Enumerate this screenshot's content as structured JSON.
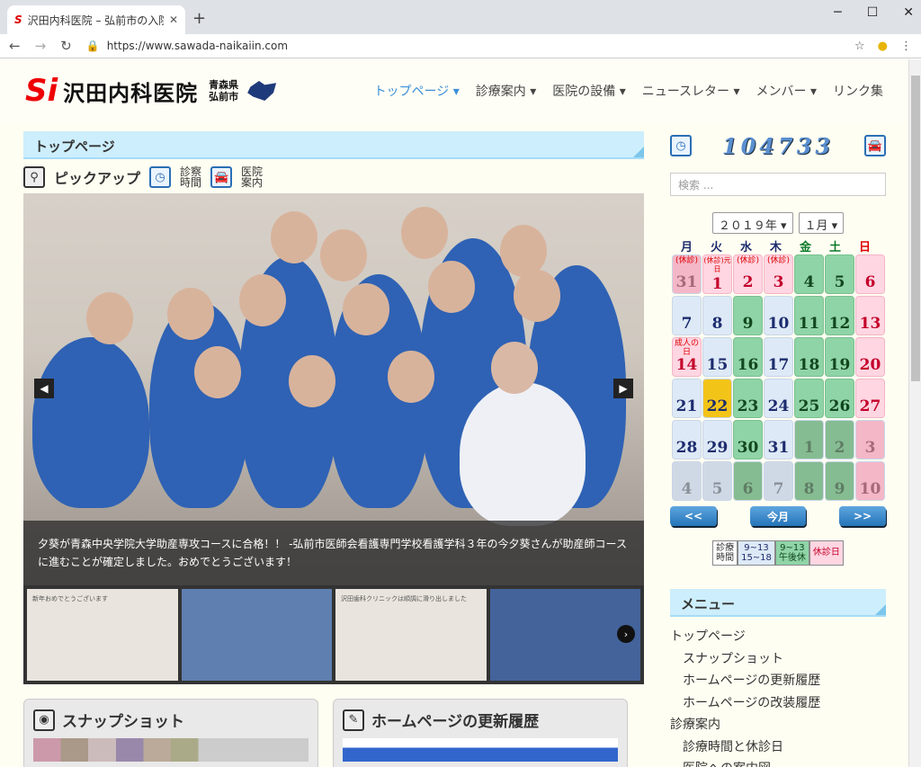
{
  "browser": {
    "tab_title": "沢田内科医院 – 弘前市の入院診療",
    "url": "https://www.sawada-naikaiin.com"
  },
  "header": {
    "logo_name": "沢田内科医院",
    "logo_loc1": "青森県",
    "logo_loc2": "弘前市",
    "menu": [
      "トップページ ▾",
      "診療案内 ▾",
      "医院の設備 ▾",
      "ニュースレター ▾",
      "メンバー ▾",
      "リンク集"
    ]
  },
  "main": {
    "section_title": "トップページ",
    "pickup": "ピックアップ",
    "link1": "診察\n時間",
    "link1a": "診察",
    "link1b": "時間",
    "link2a": "医院",
    "link2b": "案内",
    "caption": "夕葵が青森中央学院大学助産専攻コースに合格！！ -弘前市医師会看護専門学校看護学科３年の今夕葵さんが助産師コースに進むことが確定しました。おめでとうございます！",
    "thumb1": "新年おめでとうございます",
    "thumb3": "沢田歯科クリニックは順調に滑り出しました",
    "card1": "スナップショット",
    "card2": "ホームページの更新履歴"
  },
  "side": {
    "counter": "104733",
    "search_placeholder": "検索 ...",
    "year": "２０１９年 ▾",
    "month": "１月 ▾",
    "dow": [
      "月",
      "火",
      "水",
      "木",
      "金",
      "土",
      "日"
    ],
    "dow_colors": [
      "#1d2c6e",
      "#1d2c6e",
      "#1d2c6e",
      "#1d2c6e",
      "#0a7a2a",
      "#0a7a2a",
      "#d00"
    ],
    "days": [
      {
        "d": "31",
        "n": "(休診)",
        "c": "op"
      },
      {
        "d": "1",
        "n": "(休診)元日",
        "c": "p"
      },
      {
        "d": "2",
        "n": "(休診)",
        "c": "p"
      },
      {
        "d": "3",
        "n": "(休診)",
        "c": "p"
      },
      {
        "d": "4",
        "n": "",
        "c": "g"
      },
      {
        "d": "5",
        "n": "",
        "c": "g"
      },
      {
        "d": "6",
        "n": "",
        "c": "p"
      },
      {
        "d": "7",
        "n": "",
        "c": ""
      },
      {
        "d": "8",
        "n": "",
        "c": ""
      },
      {
        "d": "9",
        "n": "",
        "c": "g"
      },
      {
        "d": "10",
        "n": "",
        "c": ""
      },
      {
        "d": "11",
        "n": "",
        "c": "g"
      },
      {
        "d": "12",
        "n": "",
        "c": "g"
      },
      {
        "d": "13",
        "n": "",
        "c": "p"
      },
      {
        "d": "14",
        "n": "成人の日",
        "c": "p"
      },
      {
        "d": "15",
        "n": "",
        "c": ""
      },
      {
        "d": "16",
        "n": "",
        "c": "g"
      },
      {
        "d": "17",
        "n": "",
        "c": ""
      },
      {
        "d": "18",
        "n": "",
        "c": "g"
      },
      {
        "d": "19",
        "n": "",
        "c": "g"
      },
      {
        "d": "20",
        "n": "",
        "c": "p"
      },
      {
        "d": "21",
        "n": "",
        "c": ""
      },
      {
        "d": "22",
        "n": "",
        "c": "t"
      },
      {
        "d": "23",
        "n": "",
        "c": "g"
      },
      {
        "d": "24",
        "n": "",
        "c": ""
      },
      {
        "d": "25",
        "n": "",
        "c": "g"
      },
      {
        "d": "26",
        "n": "",
        "c": "g"
      },
      {
        "d": "27",
        "n": "",
        "c": "p"
      },
      {
        "d": "28",
        "n": "",
        "c": ""
      },
      {
        "d": "29",
        "n": "",
        "c": ""
      },
      {
        "d": "30",
        "n": "",
        "c": "g"
      },
      {
        "d": "31",
        "n": "",
        "c": ""
      },
      {
        "d": "1",
        "n": "",
        "c": "og"
      },
      {
        "d": "2",
        "n": "",
        "c": "og"
      },
      {
        "d": "3",
        "n": "",
        "c": "op"
      },
      {
        "d": "4",
        "n": "",
        "c": "o"
      },
      {
        "d": "5",
        "n": "",
        "c": "o"
      },
      {
        "d": "6",
        "n": "",
        "c": "og"
      },
      {
        "d": "7",
        "n": "",
        "c": "o"
      },
      {
        "d": "8",
        "n": "",
        "c": "og"
      },
      {
        "d": "9",
        "n": "",
        "c": "og"
      },
      {
        "d": "10",
        "n": "",
        "c": "op"
      }
    ],
    "prev": "<<",
    "today": "今月",
    "next": ">>",
    "legend": [
      "診療時間",
      "9~13 15~18",
      "9~13 午後休",
      "休診日"
    ],
    "legend_a1": "診療",
    "legend_a2": "時間",
    "legend_b1": "9~13",
    "legend_b2": "15~18",
    "legend_c1": "9~13",
    "legend_c2": "午後休",
    "legend_d": "休診日",
    "menu_title": "メニュー",
    "menu_items": [
      {
        "label": "トップページ",
        "sub": false
      },
      {
        "label": "スナップショット",
        "sub": true
      },
      {
        "label": "ホームページの更新履歴",
        "sub": true
      },
      {
        "label": "ホームページの改装履歴",
        "sub": true
      },
      {
        "label": "診療案内",
        "sub": false
      },
      {
        "label": "診療時間と休診日",
        "sub": true
      },
      {
        "label": "医院への案内図",
        "sub": true
      }
    ]
  }
}
